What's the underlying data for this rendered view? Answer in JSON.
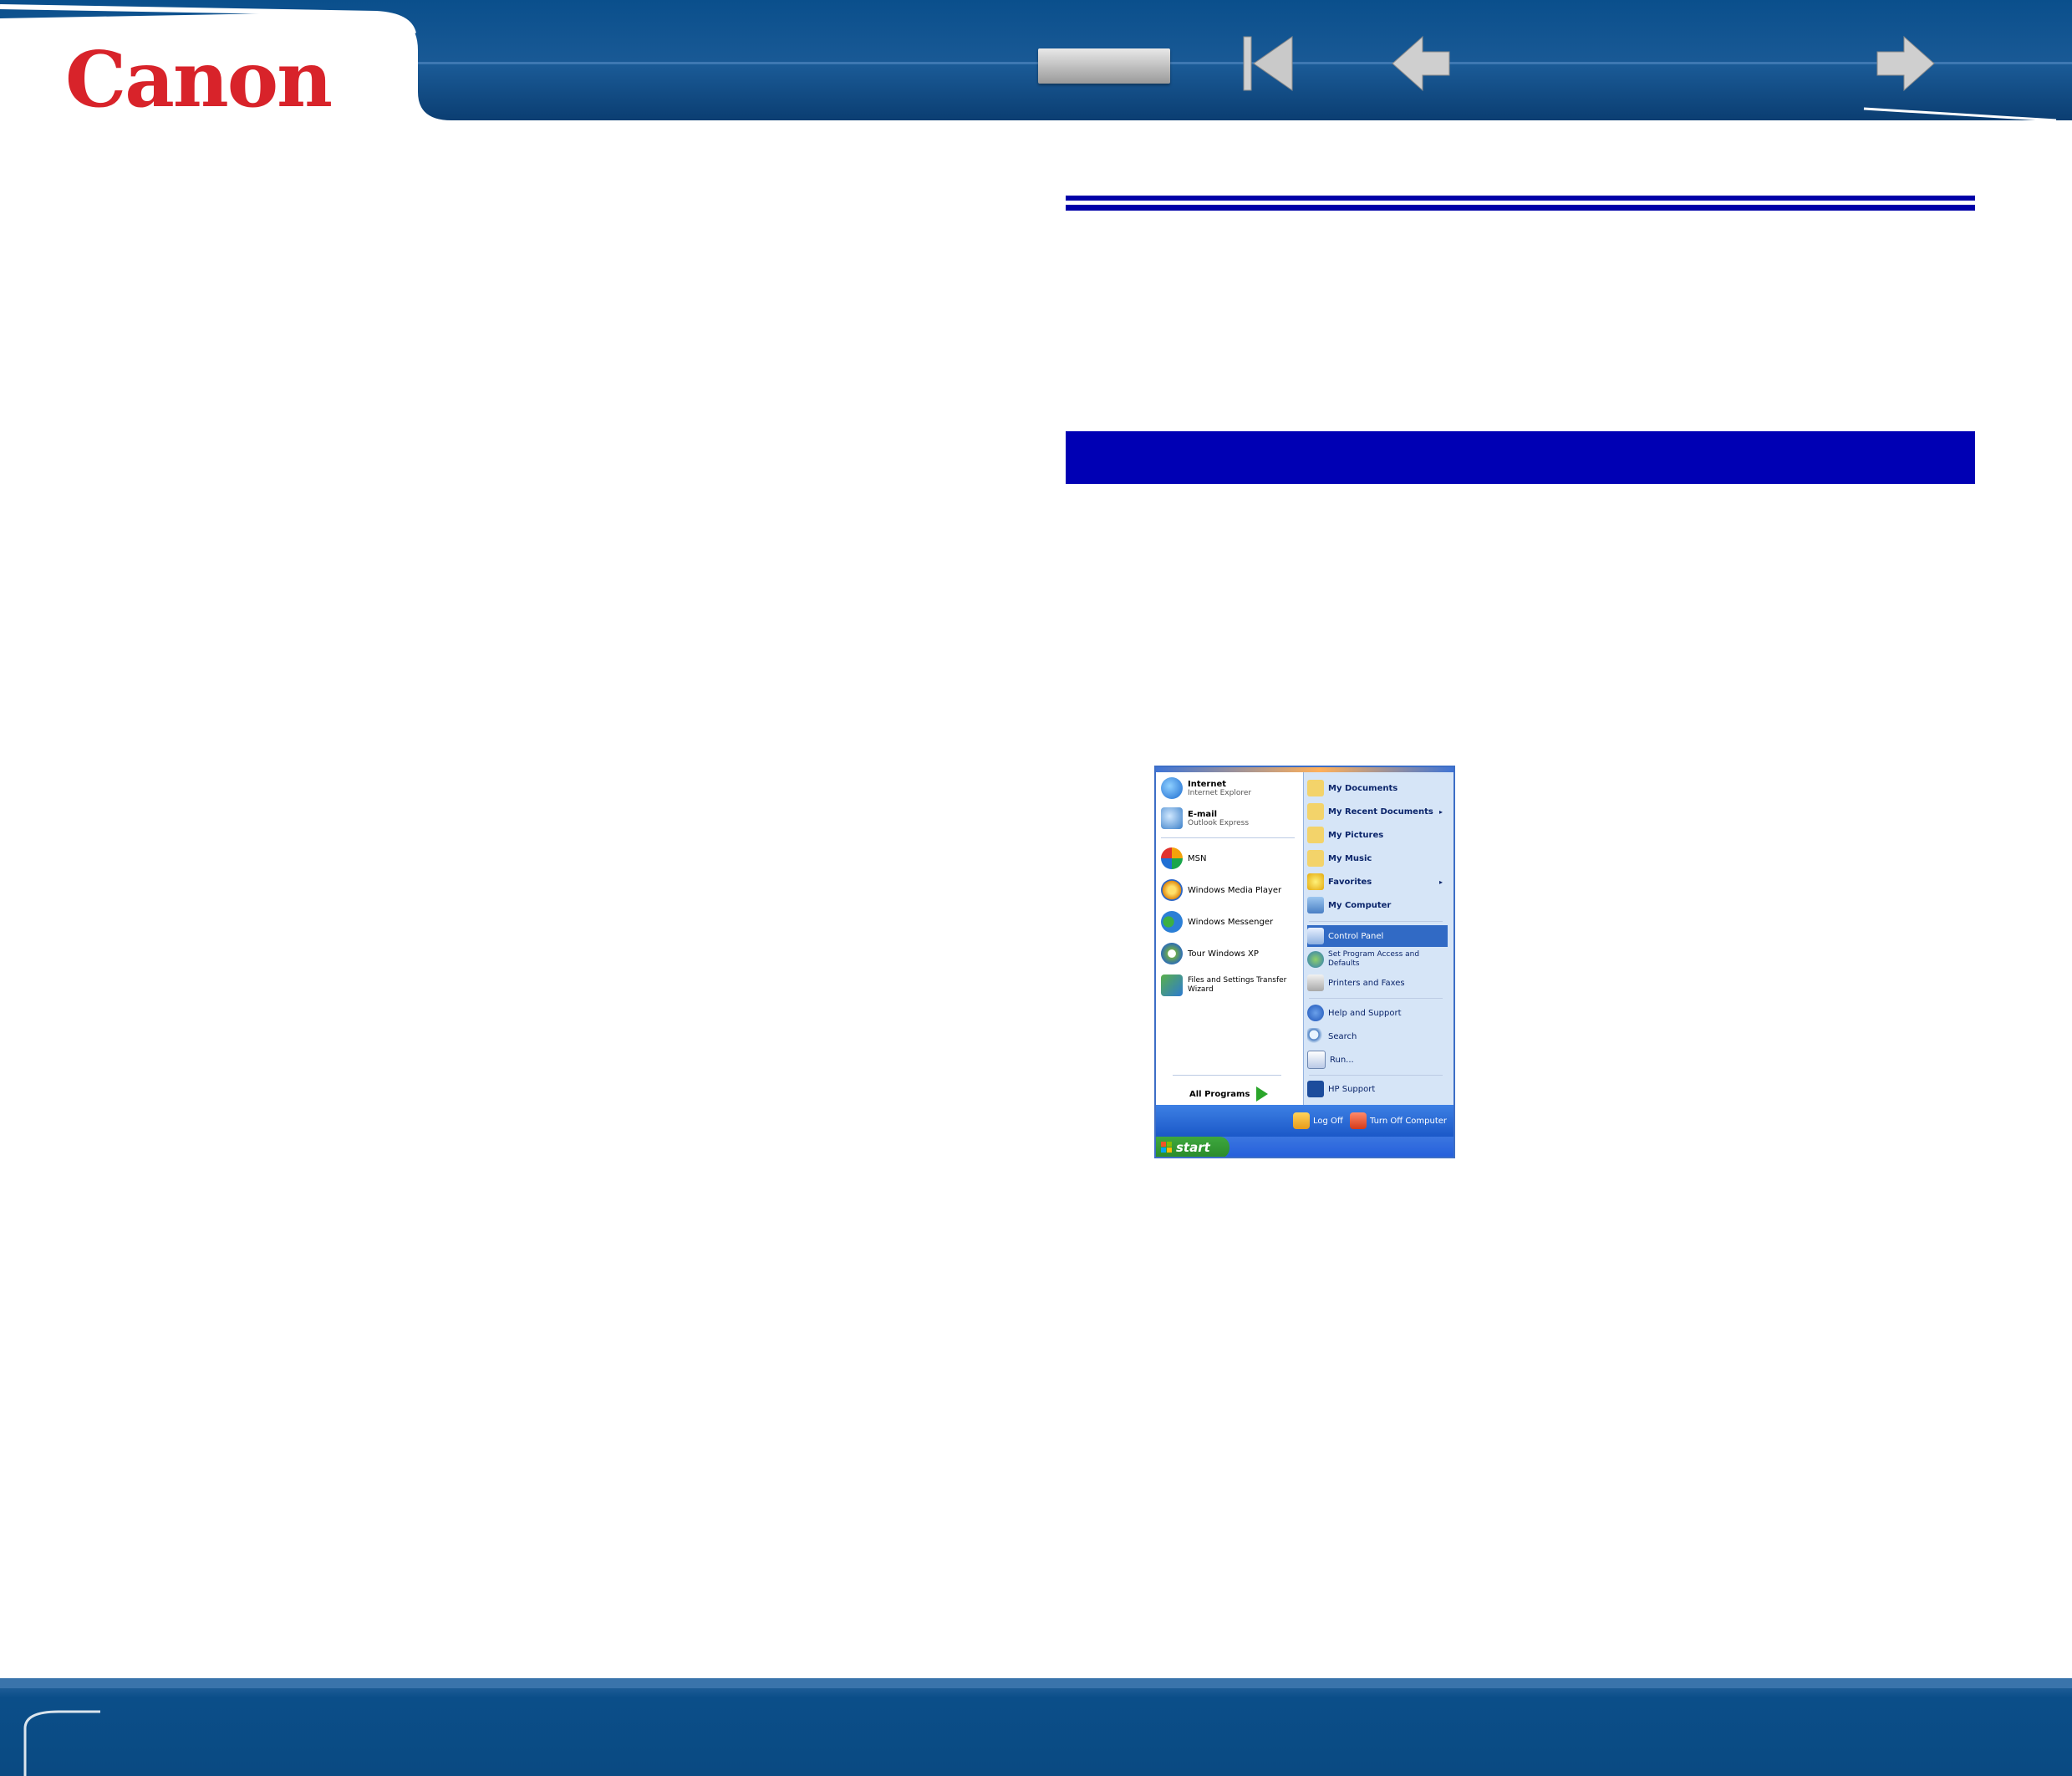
{
  "brand": {
    "logo_text": "Canon",
    "logo_color": "#d8232a",
    "header_color": "#0c4d86"
  },
  "nav": {
    "menu_button": "",
    "first_icon": "first-page-icon",
    "prev_icon": "back-arrow-icon",
    "next_icon": "forward-arrow-icon"
  },
  "start_menu": {
    "pinned": [
      {
        "title": "Internet",
        "subtitle": "Internet Explorer",
        "icon": "internet-explorer-icon"
      },
      {
        "title": "E-mail",
        "subtitle": "Outlook Express",
        "icon": "outlook-express-icon"
      }
    ],
    "recent": [
      {
        "label": "MSN",
        "icon": "msn-icon"
      },
      {
        "label": "Windows Media Player",
        "icon": "media-player-icon"
      },
      {
        "label": "Windows Messenger",
        "icon": "messenger-icon"
      },
      {
        "label": "Tour Windows XP",
        "icon": "tour-xp-icon"
      },
      {
        "label": "Files and Settings Transfer",
        "label2": "Wizard",
        "icon": "transfer-wizard-icon"
      }
    ],
    "all_programs": "All Programs",
    "places": [
      {
        "label": "My Documents",
        "icon": "folder-icon"
      },
      {
        "label": "My Recent Documents",
        "icon": "recent-docs-icon",
        "submenu": "▸"
      },
      {
        "label": "My Pictures",
        "icon": "folder-icon"
      },
      {
        "label": "My Music",
        "icon": "folder-icon"
      },
      {
        "label": "Favorites",
        "icon": "star-icon",
        "submenu": "▸"
      },
      {
        "label": "My Computer",
        "icon": "computer-icon"
      }
    ],
    "settings": [
      {
        "label": "Control Panel",
        "icon": "control-panel-icon",
        "selected": true
      },
      {
        "label": "Set Program Access and",
        "label2": "Defaults",
        "icon": "program-access-icon"
      },
      {
        "label": "Printers and Faxes",
        "icon": "printer-icon"
      }
    ],
    "system": [
      {
        "label": "Help and Support",
        "icon": "help-icon"
      },
      {
        "label": "Search",
        "icon": "search-icon"
      },
      {
        "label": "Run...",
        "icon": "run-icon"
      }
    ],
    "oem": {
      "label": "HP Support",
      "icon": "hp-icon"
    },
    "log_off": "Log Off",
    "turn_off": "Turn Off Computer",
    "start_label": "start"
  }
}
